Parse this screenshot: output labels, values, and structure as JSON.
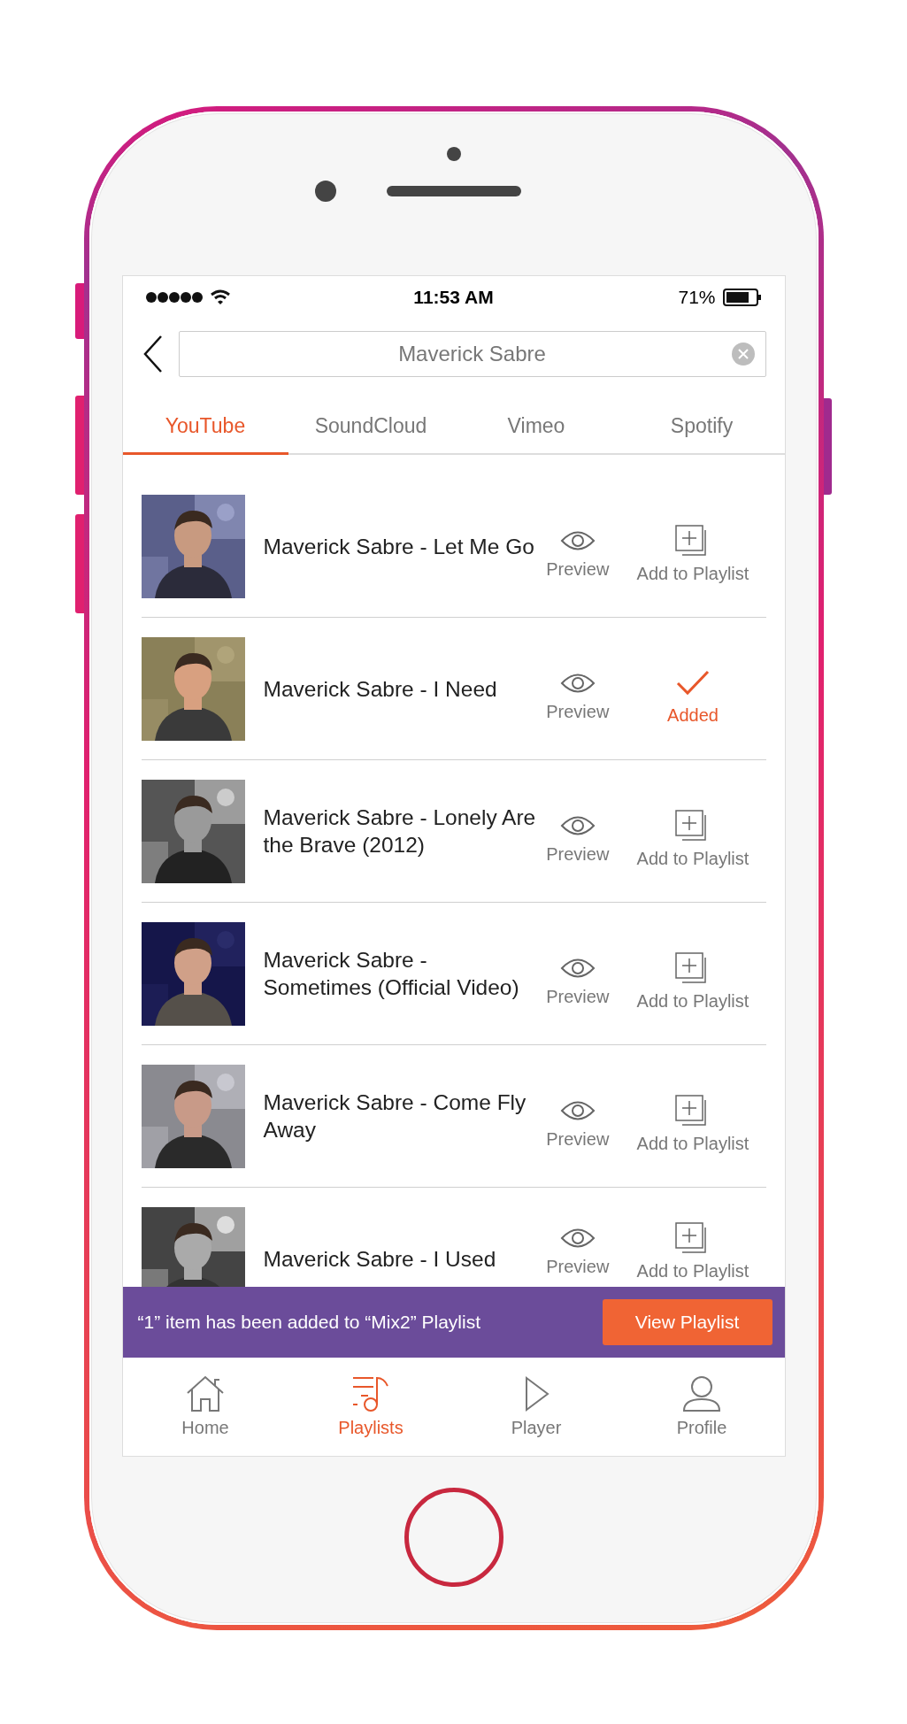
{
  "status_bar": {
    "time": "11:53 AM",
    "battery": "71%"
  },
  "search": {
    "value": "Maverick Sabre"
  },
  "tabs": [
    {
      "label": "YouTube",
      "selected": true
    },
    {
      "label": "SoundCloud",
      "selected": false
    },
    {
      "label": "Vimeo",
      "selected": false
    },
    {
      "label": "Spotify",
      "selected": false
    }
  ],
  "results": [
    {
      "title": "Maverick Sabre - Let Me Go",
      "preview_label": "Preview",
      "action_label": "Add to Playlist",
      "added": false
    },
    {
      "title": "Maverick Sabre - I Need",
      "preview_label": "Preview",
      "action_label": "Added",
      "added": true
    },
    {
      "title": "Maverick Sabre - Lonely Are the Brave (2012)",
      "preview_label": "Preview",
      "action_label": "Add to Playlist",
      "added": false
    },
    {
      "title": "Maverick Sabre - Sometimes (Official Video)",
      "preview_label": "Preview",
      "action_label": "Add to Playlist",
      "added": false
    },
    {
      "title": "Maverick Sabre - Come Fly Away",
      "preview_label": "Preview",
      "action_label": "Add to Playlist",
      "added": false
    },
    {
      "title": "Maverick Sabre - I Used",
      "preview_label": "Preview",
      "action_label": "Add to Playlist",
      "added": false
    }
  ],
  "toast": {
    "message": "“1” item has been added to  “Mix2” Playlist",
    "button": "View Playlist"
  },
  "nav": [
    {
      "label": "Home",
      "selected": false
    },
    {
      "label": "Playlists",
      "selected": true
    },
    {
      "label": "Player",
      "selected": false
    },
    {
      "label": "Profile",
      "selected": false
    }
  ]
}
